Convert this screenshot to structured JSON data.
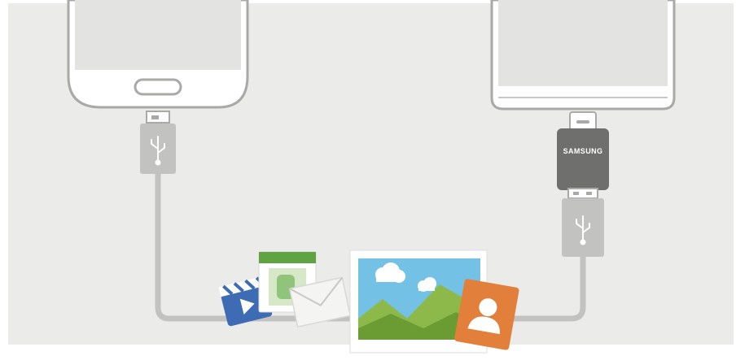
{
  "illustration": {
    "adapter_brand": "SAMSUNG",
    "colors": {
      "background": "#ebebea",
      "phone_body": "#ffffff",
      "phone_outline": "#a9a9a7",
      "screen": "#e3e3e1",
      "cable_gray": "#c2c2c0",
      "adapter_dark": "#6f6f6d",
      "video_blue": "#3d6bb4",
      "contact_orange": "#e27f3a",
      "photo_sky": "#73c2e6",
      "photo_hill": "#8db84a",
      "calendar_green": "#5fa343"
    },
    "icons": [
      "usb-icon",
      "video-clapper-icon",
      "calendar-icon",
      "envelope-icon",
      "photo-icon",
      "contact-icon"
    ]
  }
}
